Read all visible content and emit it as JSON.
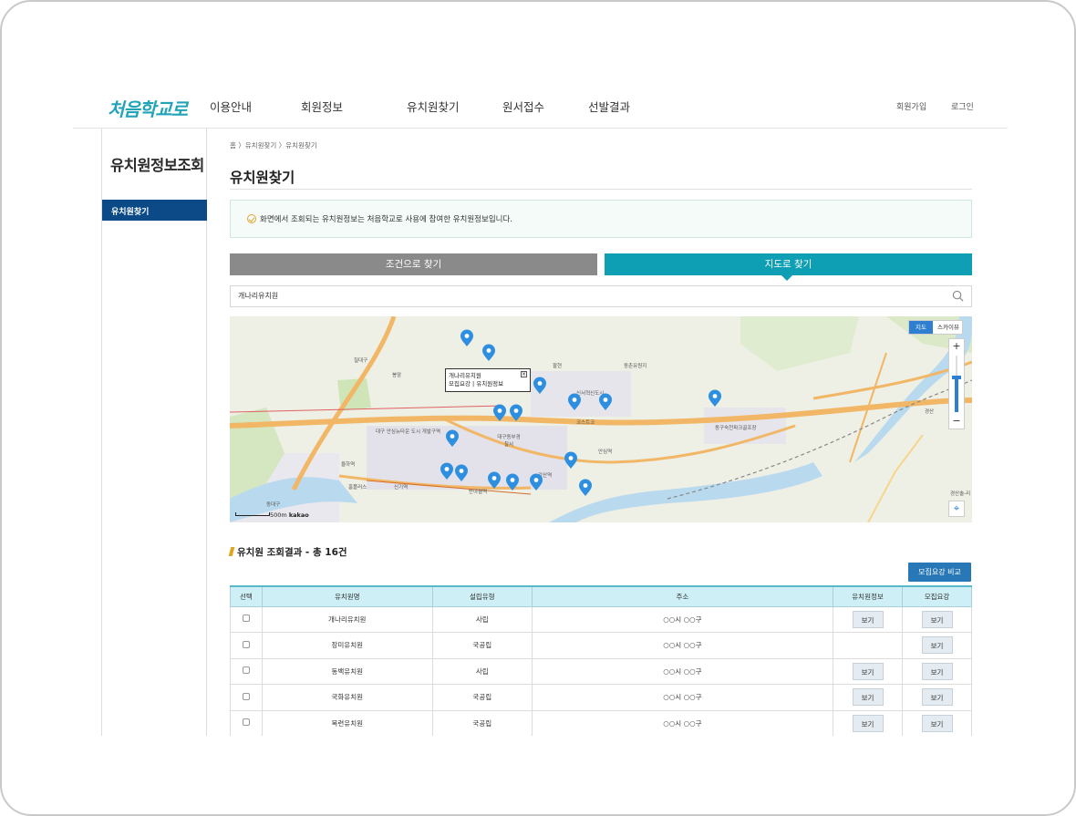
{
  "header": {
    "logo_text": "처음학교로",
    "nav": [
      "이용안내",
      "회원정보",
      "유치원찾기",
      "원서접수",
      "선발결과"
    ],
    "util": [
      "회원가입",
      "로그인"
    ]
  },
  "sidebar": {
    "title": "유치원정보조회",
    "items": [
      {
        "label": "유치원찾기"
      }
    ]
  },
  "breadcrumb": "홈 〉유치원찾기 〉유치원찾기",
  "page_title": "유치원찾기",
  "notice": "화면에서 조회되는 유치원정보는 처음학교로 사용에 참여한 유치원정보입니다.",
  "tabs": {
    "condition": "조건으로 찾기",
    "map": "지도로 찾기"
  },
  "search": {
    "value": "개나리유치원"
  },
  "map": {
    "type_toggle": {
      "map": "지도",
      "skyview": "스카이뷰"
    },
    "zoom_in": "+",
    "zoom_out": "−",
    "scale_label": "500m",
    "brand": "kakao",
    "infowindow": {
      "line1": "개나리유치원",
      "line2": "모집요강 | 유치원정보",
      "close": "×"
    },
    "labels": {
      "l1": "칠대구",
      "l2": "봉암",
      "l3": "동촌유원지",
      "l4": "팔현",
      "l5": "신서혁신도시",
      "l6": "코스트코",
      "l7": "대구동부경찰서",
      "l8": "대구 안심뉴타운 도시 개발구역",
      "l9": "동구숙천파크골프장",
      "l10": "각산역",
      "l11": "반야월역",
      "l12": "신기역",
      "l13": "율하역",
      "l14": "홈플러스",
      "l15": "경산",
      "l16": "안심역",
      "l17": "경산솔-리",
      "l18": "동대구"
    },
    "accent_color": "#2e8fe0"
  },
  "results": {
    "title": "유치원 조회결과 - 총 16건",
    "compare_button": "모집요강 비교",
    "columns": [
      "선택",
      "유치원명",
      "설립유형",
      "주소",
      "유치원정보",
      "모집요강"
    ],
    "view_label": "보기",
    "rows": [
      {
        "name": "개나리유치원",
        "type": "사립",
        "address": "○○시 ○○구",
        "has_info": true
      },
      {
        "name": "장미유치원",
        "type": "국공립",
        "address": "○○시 ○○구",
        "has_info": false
      },
      {
        "name": "동백유치원",
        "type": "사립",
        "address": "○○시 ○○구",
        "has_info": true
      },
      {
        "name": "국화유치원",
        "type": "국공립",
        "address": "○○시 ○○구",
        "has_info": true
      },
      {
        "name": "목련유치원",
        "type": "국공립",
        "address": "○○시 ○○구",
        "has_info": true
      }
    ]
  }
}
